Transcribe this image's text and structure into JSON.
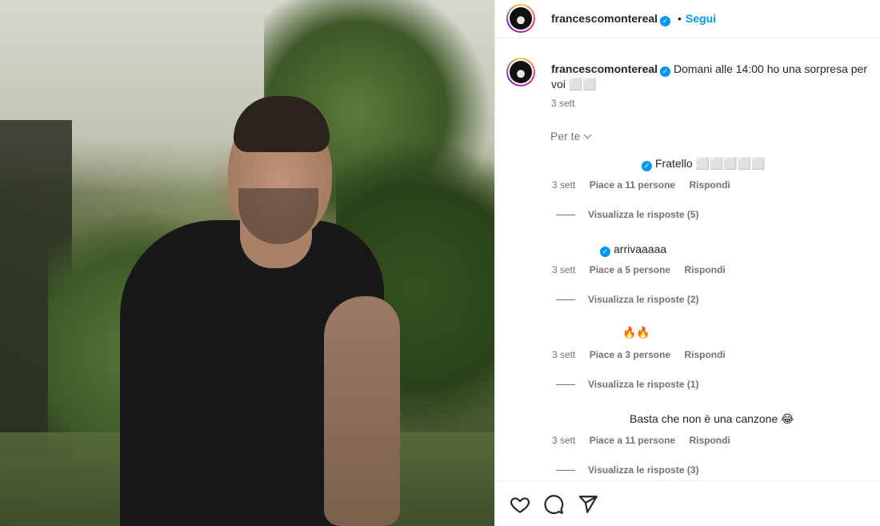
{
  "post": {
    "username": "francescomontereal",
    "dot": "•",
    "follow_label": "Segui",
    "caption": "Domani alle 14:00 ho una sorpresa per voi ⬜⬜",
    "time": "3 sett"
  },
  "filter": {
    "label": "Per te"
  },
  "comments": [
    {
      "text": "Fratello ⬜⬜⬜⬜⬜",
      "verified": true,
      "time": "3 sett",
      "likes": "Piace a 11 persone",
      "reply": "Rispondi",
      "replies": "Visualizza le risposte (5)"
    },
    {
      "text": "arrivaaaaa",
      "verified": true,
      "time": "3 sett",
      "likes": "Piace a 5 persone",
      "reply": "Rispondi",
      "replies": "Visualizza le risposte (2)"
    },
    {
      "text": "🔥🔥",
      "verified": false,
      "time": "3 sett",
      "likes": "Piace a 3 persone",
      "reply": "Rispondi",
      "replies": "Visualizza le risposte (1)"
    },
    {
      "text": "Basta che non è una canzone 😂",
      "verified": false,
      "time": "3 sett",
      "likes": "Piace a 11 persone",
      "reply": "Rispondi",
      "replies": "Visualizza le risposte (3)"
    }
  ],
  "actions": [
    "heart-icon",
    "comment-icon",
    "share-icon"
  ],
  "colors": {
    "accent": "#0095f6",
    "muted": "#737373",
    "text": "#262626"
  }
}
